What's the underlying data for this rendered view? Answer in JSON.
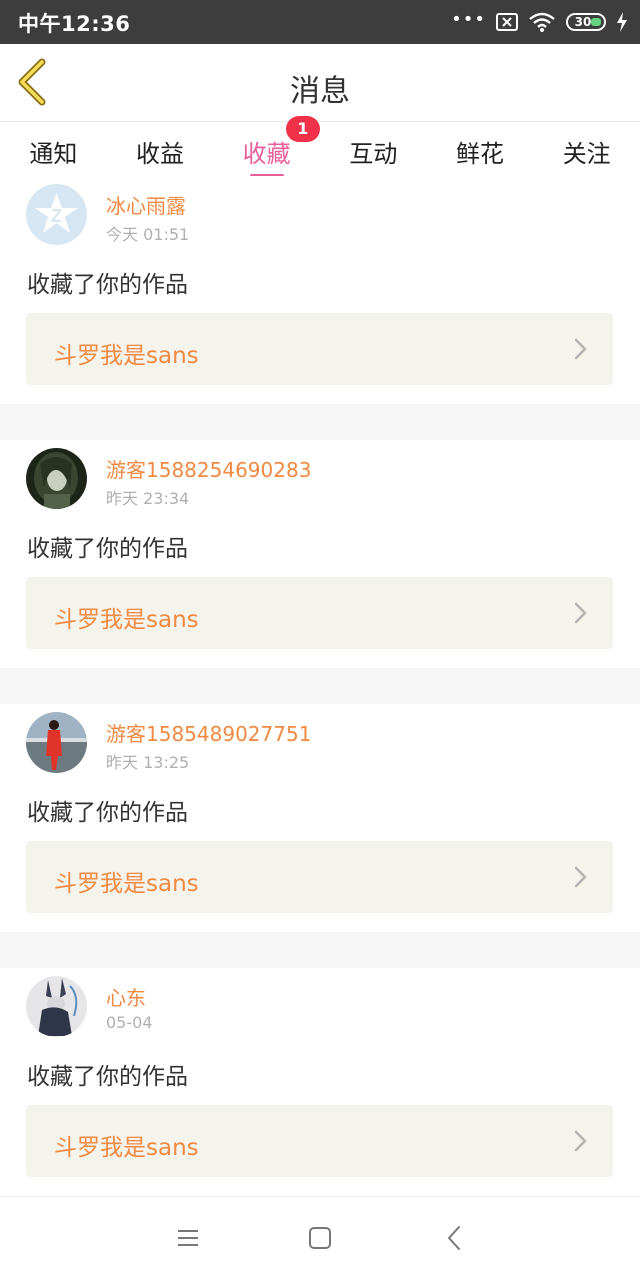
{
  "status_bar": {
    "time": "中午12:36",
    "dots": "•••",
    "battery": "30"
  },
  "navbar": {
    "title": "消息"
  },
  "tabs": [
    {
      "label": "通知"
    },
    {
      "label": "收益"
    },
    {
      "label": "收藏",
      "badge": "1"
    },
    {
      "label": "互动"
    },
    {
      "label": "鲜花"
    },
    {
      "label": "关注"
    }
  ],
  "messages": [
    {
      "username": "冰心雨露",
      "time": "今天 01:51",
      "action": "收藏了你的作品",
      "work": "斗罗我是sans",
      "avatar": "qq-default-avatar"
    },
    {
      "username": "游客1588254690283",
      "time": "昨天 23:34",
      "action": "收藏了你的作品",
      "work": "斗罗我是sans",
      "avatar": "anime-girl-avatar"
    },
    {
      "username": "游客1585489027751",
      "time": "昨天 13:25",
      "action": "收藏了你的作品",
      "work": "斗罗我是sans",
      "avatar": "person-red-avatar"
    },
    {
      "username": "心东",
      "time": "05-04",
      "action": "收藏了你的作品",
      "work": "斗罗我是sans",
      "avatar": "rabbit-character-avatar"
    }
  ],
  "colors": {
    "accent": "#e8609b",
    "username": "#f08a43",
    "badge": "#f0314a",
    "card_bg": "#f4f3ec"
  }
}
